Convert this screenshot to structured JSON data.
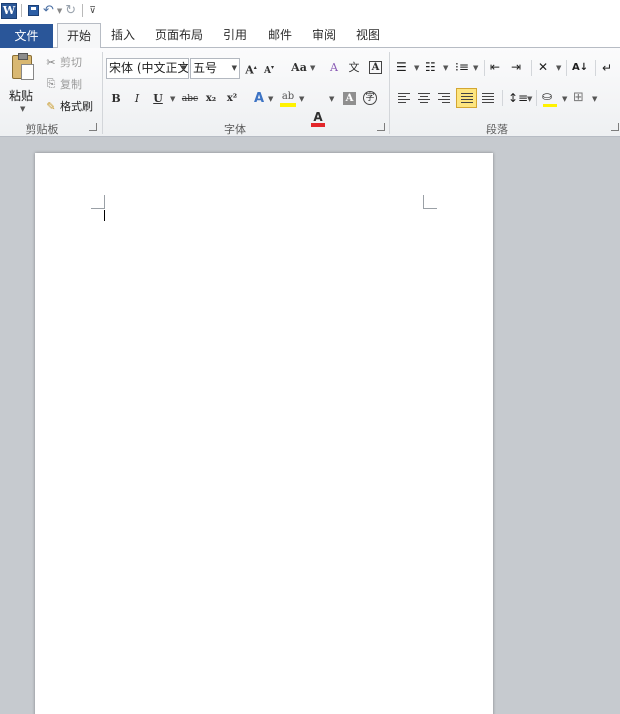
{
  "quick_access": {
    "app_icon_letter": "W",
    "icons": [
      "word-app-icon",
      "save-icon",
      "undo-icon",
      "redo-icon",
      "customize-qat-icon"
    ]
  },
  "tabs": {
    "file": "文件",
    "home": "开始",
    "insert": "插入",
    "page_layout": "页面布局",
    "references": "引用",
    "mailings": "邮件",
    "review": "审阅",
    "view": "视图",
    "active": "开始"
  },
  "clipboard": {
    "paste": "粘贴",
    "cut": "剪切",
    "copy": "复制",
    "format_painter": "格式刷",
    "group_label": "剪贴板"
  },
  "font": {
    "font_name": "宋体 (中文正文",
    "font_size": "五号",
    "grow": "A",
    "shrink": "A",
    "change_case": "Aa",
    "clear_format": "A",
    "phonetic": "文",
    "char_border": "A",
    "bold": "B",
    "italic": "I",
    "underline": "U",
    "strikethrough": "abc",
    "subscript": "x₂",
    "superscript": "x²",
    "text_effects": "A",
    "highlight": "ab",
    "font_color": "A",
    "char_shading": "A",
    "enclose": "字",
    "group_label": "字体",
    "colors": {
      "highlight": "#fff200",
      "font_color": "#e3262a"
    }
  },
  "paragraph": {
    "group_label": "段落",
    "sort": "A↓"
  }
}
